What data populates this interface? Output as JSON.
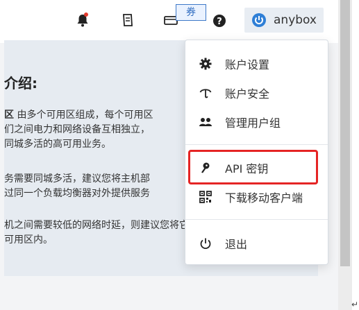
{
  "header": {
    "coupon_label": "券",
    "account_name": "anybox"
  },
  "intro": {
    "title": "介绍:",
    "p1_prefix": "区",
    "p1_line1": " 由多个可用区组成，每个可用区",
    "p1_line2": "们之间电力和网络设备互相独立，",
    "p1_line3": "同城多活的高可用业务。",
    "p2_line1": "务需要同城多活，建议您将主机部",
    "p2_line2": "过同一个负载均衡器对外提供服务",
    "p3_line1": "机之间需要较低的网络时延，则建议您将它们部署在",
    "p3_line2": "可用区内。"
  },
  "menu": {
    "items": [
      {
        "label": "账户设置",
        "icon": "gear-icon"
      },
      {
        "label": "账户安全",
        "icon": "umbrella-icon"
      },
      {
        "label": "管理用户组",
        "icon": "users-icon"
      },
      {
        "label": "API 密钥",
        "icon": "key-icon"
      },
      {
        "label": "下载移动客户端",
        "icon": "qrcode-icon"
      },
      {
        "label": "退出",
        "icon": "power-icon"
      }
    ]
  },
  "colors": {
    "highlight": "#e52424",
    "coupon_border": "#3d78c8",
    "notification_dot": "#e23b2e",
    "brand_blue": "#2f7fd6"
  }
}
